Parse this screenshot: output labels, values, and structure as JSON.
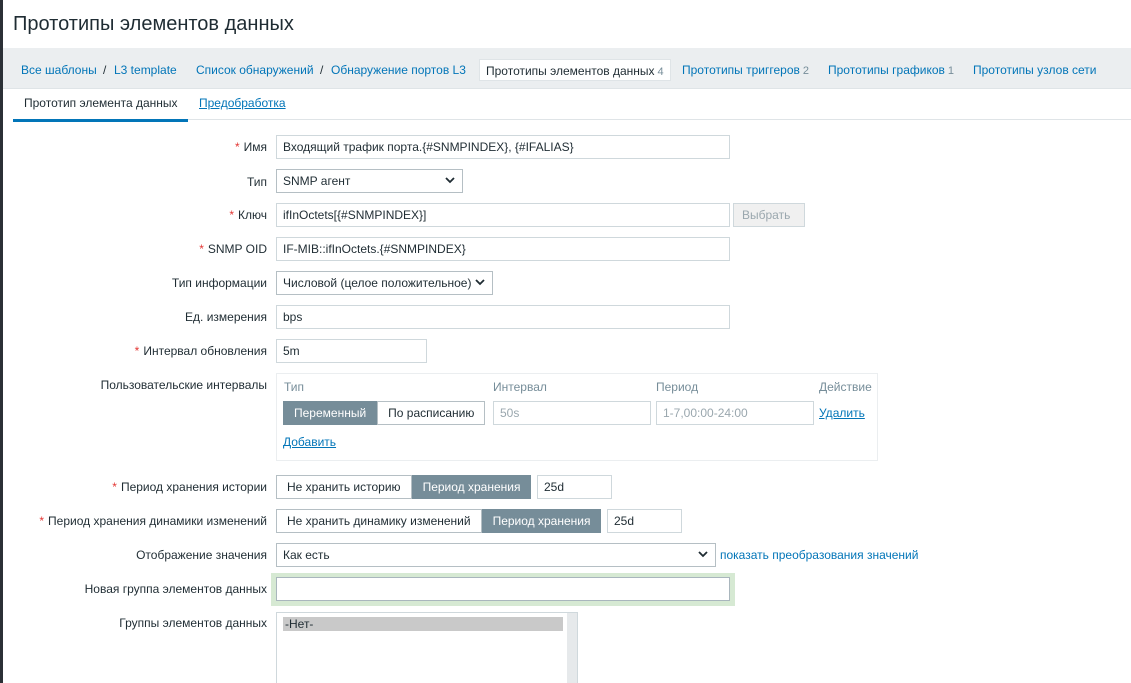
{
  "page": {
    "title": "Прототипы элементов данных"
  },
  "breadcrumbs": {
    "all_templates": "Все шаблоны",
    "sep": "/",
    "template": "L3 template",
    "discovery_list": "Список обнаружений",
    "discovery_rule": "Обнаружение портов L3",
    "item_prototypes": "Прототипы элементов данных",
    "item_prototypes_count": "4",
    "trigger_prototypes": "Прототипы триггеров",
    "trigger_prototypes_count": "2",
    "graph_prototypes": "Прототипы графиков",
    "graph_prototypes_count": "1",
    "host_prototypes": "Прототипы узлов сети"
  },
  "tabs": {
    "item_prototype": "Прототип элемента данных",
    "preprocessing": "Предобработка"
  },
  "form": {
    "name": {
      "label": "Имя",
      "value": "Входящий трафик порта.{#SNMPINDEX},  {#IFALIAS}"
    },
    "type": {
      "label": "Тип",
      "value": "SNMP агент"
    },
    "key": {
      "label": "Ключ",
      "value": "ifInOctets[{#SNMPINDEX}]",
      "select_button": "Выбрать"
    },
    "snmp_oid": {
      "label": "SNMP OID",
      "value": "IF-MIB::ifInOctets.{#SNMPINDEX}"
    },
    "info_type": {
      "label": "Тип информации",
      "value": "Числовой (целое положительное)"
    },
    "units": {
      "label": "Ед. измерения",
      "value": "bps"
    },
    "update_interval": {
      "label": "Интервал обновления",
      "value": "5m"
    },
    "custom_intervals": {
      "label": "Пользовательские интервалы",
      "col_type": "Тип",
      "col_interval": "Интервал",
      "col_period": "Период",
      "col_action": "Действие",
      "flexible": "Переменный",
      "scheduling": "По расписанию",
      "interval_placeholder": "50s",
      "period_placeholder": "1-7,00:00-24:00",
      "remove": "Удалить",
      "add": "Добавить"
    },
    "history": {
      "label": "Период хранения истории",
      "do_not_keep": "Не хранить историю",
      "storage_period": "Период хранения",
      "value": "25d"
    },
    "trends": {
      "label": "Период хранения динамики изменений",
      "do_not_keep": "Не хранить динамику изменений",
      "storage_period": "Период хранения",
      "value": "25d"
    },
    "value_map": {
      "label": "Отображение значения",
      "value": "Как есть",
      "show_link": "показать преобразования значений"
    },
    "new_app": {
      "label": "Новая группа элементов данных",
      "value": ""
    },
    "apps": {
      "label": "Группы элементов данных",
      "option": "-Нет-"
    }
  },
  "colors": {
    "accent": "#0275b8",
    "required": "#e33734",
    "segment_on": "#768d99"
  }
}
